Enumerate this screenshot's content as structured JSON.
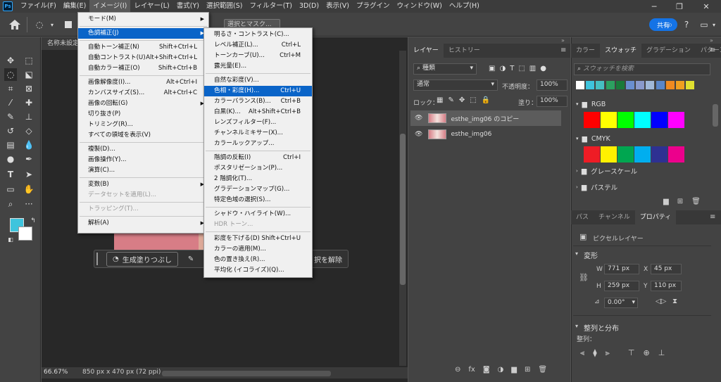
{
  "menubar": {
    "logo": "Ps",
    "items": [
      "ファイル(F)",
      "編集(E)",
      "イメージ(I)",
      "レイヤー(L)",
      "書式(Y)",
      "選択範囲(S)",
      "フィルター(T)",
      "3D(D)",
      "表示(V)",
      "プラグイン",
      "ウィンドウ(W)",
      "ヘルプ(H)"
    ],
    "minimize": "─",
    "maximize": "❐",
    "close": "✕"
  },
  "optbar": {
    "select_mask": "選択とマスク...",
    "share": "共有"
  },
  "doc": {
    "tab": "名称未設定",
    "zoom": "66.67%",
    "size": "850 px x 470 px (72 ppi)",
    "gen_fill": "生成塗りつぶし",
    "deselect": "択を解除"
  },
  "image_menu": [
    {
      "label": "モード(M)",
      "arrow": true
    },
    {
      "sep": true
    },
    {
      "label": "色調補正(J)",
      "arrow": true,
      "hl": true
    },
    {
      "sep": true
    },
    {
      "label": "自動トーン補正(N)",
      "sc": "Shift+Ctrl+L"
    },
    {
      "label": "自動コントラスト(U)",
      "sc": "Alt+Shift+Ctrl+L"
    },
    {
      "label": "自動カラー補正(O)",
      "sc": "Shift+Ctrl+B"
    },
    {
      "sep": true
    },
    {
      "label": "画像解像度(I)...",
      "sc": "Alt+Ctrl+I"
    },
    {
      "label": "カンバスサイズ(S)...",
      "sc": "Alt+Ctrl+C"
    },
    {
      "label": "画像の回転(G)",
      "arrow": true
    },
    {
      "label": "切り抜き(P)"
    },
    {
      "label": "トリミング(R)..."
    },
    {
      "label": "すべての領域を表示(V)"
    },
    {
      "sep": true
    },
    {
      "label": "複製(D)..."
    },
    {
      "label": "画像操作(Y)..."
    },
    {
      "label": "演算(C)..."
    },
    {
      "sep": true
    },
    {
      "label": "変数(B)",
      "arrow": true
    },
    {
      "label": "データセットを適用(L)...",
      "dis": true
    },
    {
      "sep": true
    },
    {
      "label": "トラッピング(T)...",
      "dis": true
    },
    {
      "sep": true
    },
    {
      "label": "解析(A)",
      "arrow": true
    }
  ],
  "adjust_menu": [
    {
      "label": "明るさ・コントラスト(C)..."
    },
    {
      "label": "レベル補正(L)...",
      "sc": "Ctrl+L"
    },
    {
      "label": "トーンカーブ(U)...",
      "sc": "Ctrl+M"
    },
    {
      "label": "露光量(E)..."
    },
    {
      "sep": true
    },
    {
      "label": "自然な彩度(V)..."
    },
    {
      "label": "色相・彩度(H)...",
      "sc": "Ctrl+U",
      "hl": true
    },
    {
      "label": "カラーバランス(B)...",
      "sc": "Ctrl+B"
    },
    {
      "label": "白黒(K)...",
      "sc": "Alt+Shift+Ctrl+B"
    },
    {
      "label": "レンズフィルター(F)..."
    },
    {
      "label": "チャンネルミキサー(X)..."
    },
    {
      "label": "カラールックアップ..."
    },
    {
      "sep": true
    },
    {
      "label": "階調の反転(I)",
      "sc": "Ctrl+I"
    },
    {
      "label": "ポスタリゼーション(P)..."
    },
    {
      "label": "2 階調化(T)..."
    },
    {
      "label": "グラデーションマップ(G)..."
    },
    {
      "label": "特定色域の選択(S)..."
    },
    {
      "sep": true
    },
    {
      "label": "シャドウ・ハイライト(W)..."
    },
    {
      "label": "HDR トーン...",
      "dis": true
    },
    {
      "sep": true
    },
    {
      "label": "彩度を下げる(D)",
      "sc": "Shift+Ctrl+U"
    },
    {
      "label": "カラーの適用(M)..."
    },
    {
      "label": "色の置き換え(R)..."
    },
    {
      "label": "平均化 (イコライズ)(Q)..."
    }
  ],
  "layers": {
    "tabs": [
      "レイヤー",
      "ヒストリー"
    ],
    "filter": "種類",
    "blend": "通常",
    "opacity_label": "不透明度：",
    "opacity": "100%",
    "lock_label": "ロック：",
    "fill_label": "塗り：",
    "fill": "100%",
    "rows": [
      "esthe_img06 のコピー",
      "esthe_img06"
    ]
  },
  "swatches": {
    "tabs": [
      "カラー",
      "スウォッチ",
      "グラデーション",
      "パターン"
    ],
    "search": "スウォッチを検索",
    "recent": [
      "#ffffff",
      "#3ec4dd",
      "#46bfc2",
      "#2ca060",
      "#1a7a3a",
      "#6a8fd0",
      "#8a9acc",
      "#a0b8d8",
      "#5a86c8",
      "#f08a20",
      "#f0a020",
      "#e0e030"
    ],
    "groups": [
      {
        "name": "RGB",
        "colors": [
          "#ff0000",
          "#ffff00",
          "#00ff00",
          "#00ffff",
          "#0000ff",
          "#ff00ff"
        ]
      },
      {
        "name": "CMYK",
        "colors": [
          "#ee1c25",
          "#fff100",
          "#00a650",
          "#00aeef",
          "#2e3192",
          "#ec008c"
        ]
      },
      {
        "name": "グレースケール"
      },
      {
        "name": "パステル"
      }
    ]
  },
  "props": {
    "tabs": [
      "パス",
      "チャンネル",
      "プロパティ"
    ],
    "kind": "ピクセルレイヤー",
    "transform": "変形",
    "w": "771 px",
    "x": "45 px",
    "h": "259 px",
    "y": "110 px",
    "angle": "0.00°",
    "align": "整列と分布",
    "align_sub": "整列："
  }
}
